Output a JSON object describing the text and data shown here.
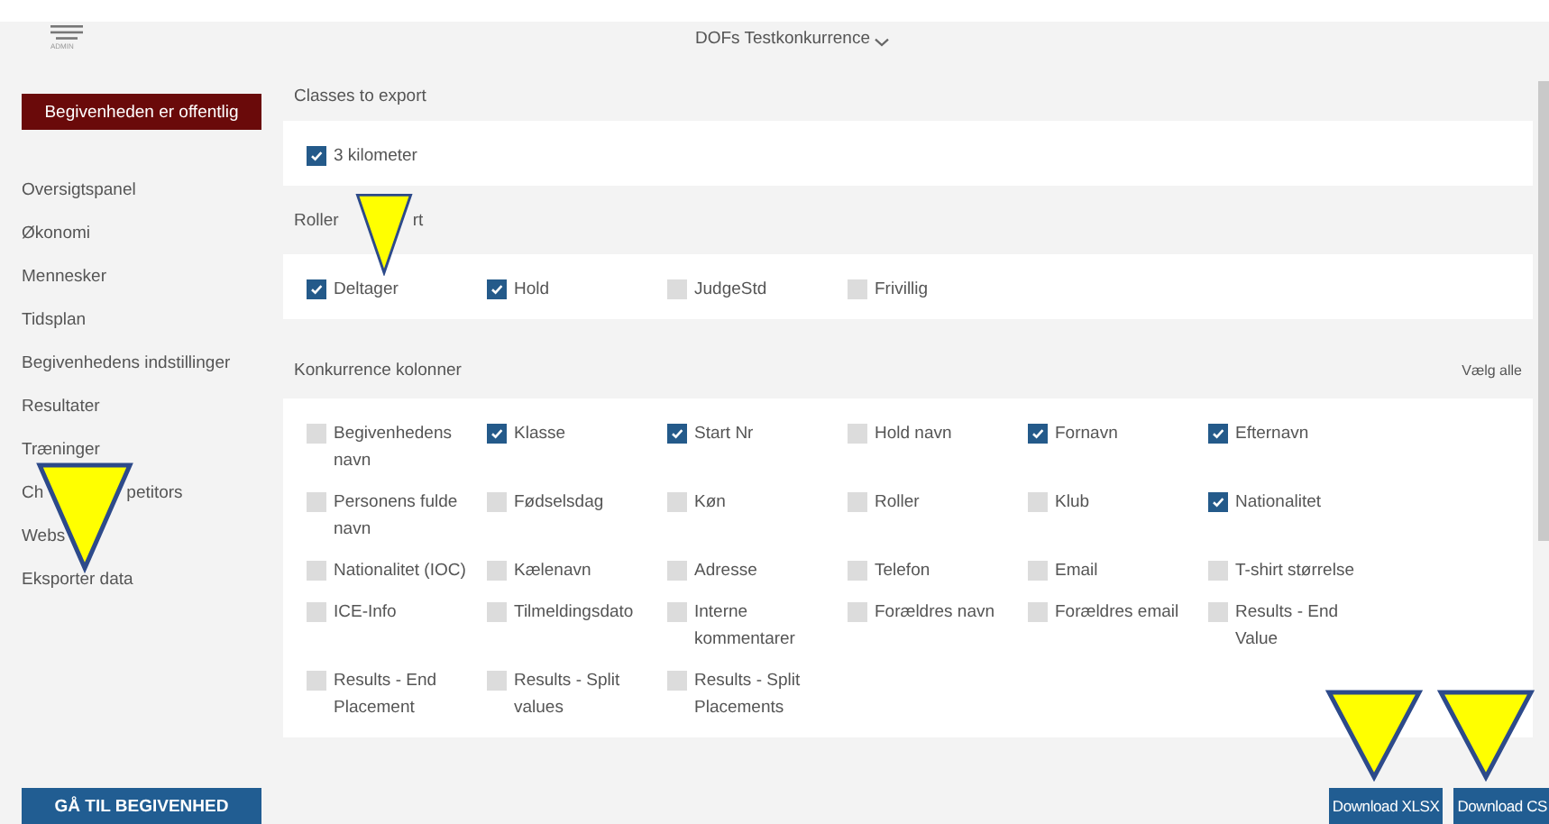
{
  "header": {
    "menu_label": "ADMIN",
    "title": "DOFs Testkonkurrence"
  },
  "sidebar": {
    "status_button": "Begivenheden er offentlig",
    "items": [
      {
        "label_parts": [
          "Oversigtspanel"
        ]
      },
      {
        "label_parts": [
          "Økonomi"
        ]
      },
      {
        "label_parts": [
          "Mennesker"
        ]
      },
      {
        "label_parts": [
          "Tidsplan"
        ]
      },
      {
        "label_parts": [
          "Begivenhedens indstillinger"
        ]
      },
      {
        "label_parts": [
          "Resultater"
        ]
      },
      {
        "label_parts": [
          "Træninger"
        ]
      },
      {
        "label_parts": [
          "Ch",
          "petitors"
        ]
      },
      {
        "label_parts": [
          "Webs"
        ]
      },
      {
        "label_parts": [
          "Eksporter data"
        ]
      }
    ],
    "bottom_button": "GÅ TIL BEGIVENHED"
  },
  "sections": [
    {
      "title_parts": [
        "Classes to export"
      ],
      "options": [
        {
          "label": "3 kilometer",
          "checked": true
        }
      ]
    },
    {
      "title_parts": [
        "Roller",
        "rt"
      ],
      "options": [
        {
          "label": "Deltager",
          "checked": true
        },
        {
          "label": "Hold",
          "checked": true
        },
        {
          "label": "JudgeStd",
          "checked": false
        },
        {
          "label": "Frivillig",
          "checked": false
        }
      ]
    },
    {
      "title_parts": [
        "Konkurrence kolonner"
      ],
      "action": "Vælg alle",
      "options": [
        {
          "label": "Begivenhedens navn",
          "checked": false
        },
        {
          "label": "Klasse",
          "checked": true
        },
        {
          "label": "Start Nr",
          "checked": true
        },
        {
          "label": "Hold navn",
          "checked": false
        },
        {
          "label": "Fornavn",
          "checked": true
        },
        {
          "label": "Efternavn",
          "checked": true
        },
        {
          "label": "Personens fulde navn",
          "checked": false
        },
        {
          "label": "Fødselsdag",
          "checked": false
        },
        {
          "label": "Køn",
          "checked": false
        },
        {
          "label": "Roller",
          "checked": false
        },
        {
          "label": "Klub",
          "checked": false
        },
        {
          "label": "Nationalitet",
          "checked": true
        },
        {
          "label": "Nationalitet (IOC)",
          "checked": false
        },
        {
          "label": "Kælenavn",
          "checked": false
        },
        {
          "label": "Adresse",
          "checked": false
        },
        {
          "label": "Telefon",
          "checked": false
        },
        {
          "label": "Email",
          "checked": false
        },
        {
          "label": "T-shirt størrelse",
          "checked": false
        },
        {
          "label": "ICE-Info",
          "checked": false
        },
        {
          "label": "Tilmeldingsdato",
          "checked": false
        },
        {
          "label": "Interne kommentarer",
          "checked": false
        },
        {
          "label": "Forældres navn",
          "checked": false
        },
        {
          "label": "Forældres email",
          "checked": false
        },
        {
          "label": "Results - End Value",
          "checked": false
        },
        {
          "label": "Results - End Placement",
          "checked": false
        },
        {
          "label": "Results - Split values",
          "checked": false
        },
        {
          "label": "Results - Split Placements",
          "checked": false
        }
      ]
    }
  ],
  "footer_buttons": [
    "Download XLSX",
    "Download CS"
  ]
}
